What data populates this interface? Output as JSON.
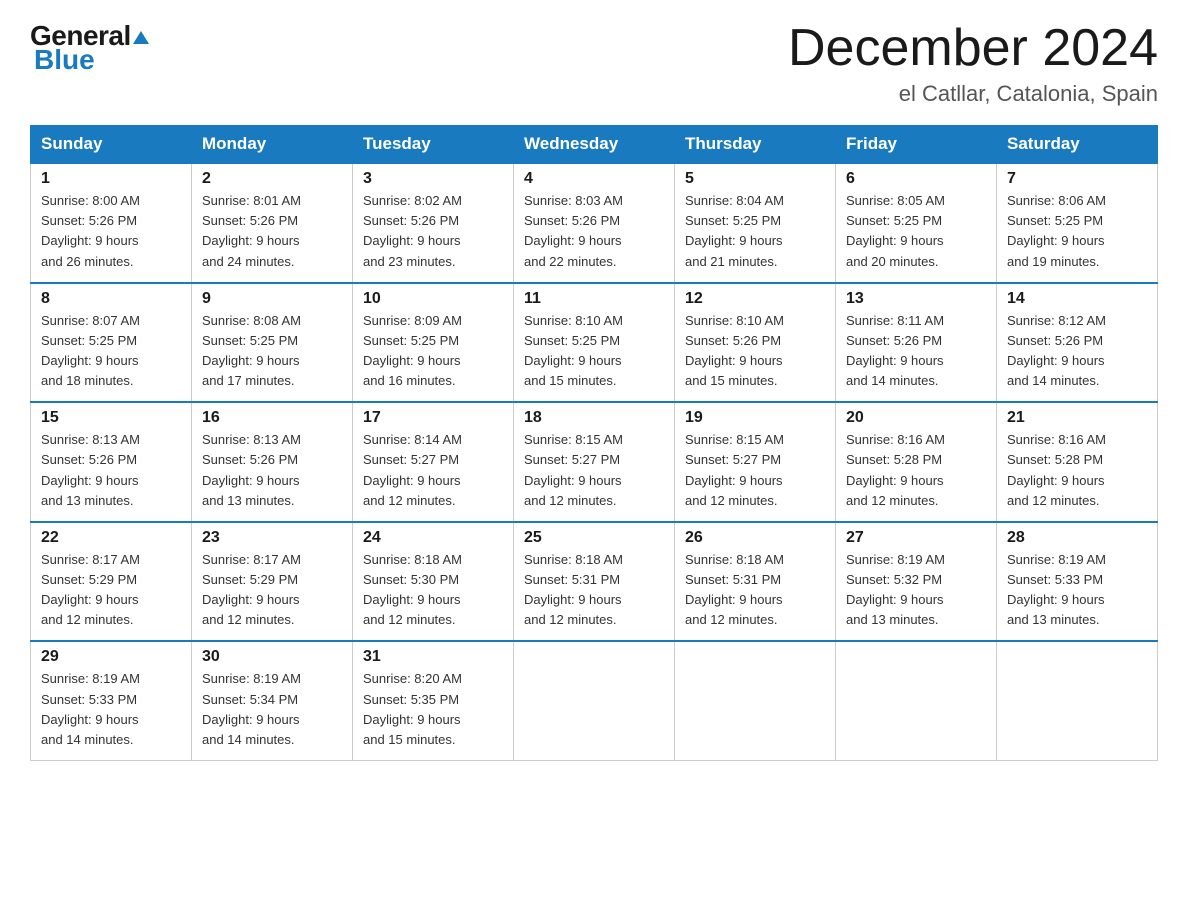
{
  "logo": {
    "general": "General",
    "blue": "Blue",
    "triangle": "▲"
  },
  "header": {
    "title": "December 2024",
    "subtitle": "el Catllar, Catalonia, Spain"
  },
  "days_of_week": [
    "Sunday",
    "Monday",
    "Tuesday",
    "Wednesday",
    "Thursday",
    "Friday",
    "Saturday"
  ],
  "weeks": [
    [
      {
        "day": "1",
        "sunrise": "8:00 AM",
        "sunset": "5:26 PM",
        "daylight": "9 hours and 26 minutes."
      },
      {
        "day": "2",
        "sunrise": "8:01 AM",
        "sunset": "5:26 PM",
        "daylight": "9 hours and 24 minutes."
      },
      {
        "day": "3",
        "sunrise": "8:02 AM",
        "sunset": "5:26 PM",
        "daylight": "9 hours and 23 minutes."
      },
      {
        "day": "4",
        "sunrise": "8:03 AM",
        "sunset": "5:26 PM",
        "daylight": "9 hours and 22 minutes."
      },
      {
        "day": "5",
        "sunrise": "8:04 AM",
        "sunset": "5:25 PM",
        "daylight": "9 hours and 21 minutes."
      },
      {
        "day": "6",
        "sunrise": "8:05 AM",
        "sunset": "5:25 PM",
        "daylight": "9 hours and 20 minutes."
      },
      {
        "day": "7",
        "sunrise": "8:06 AM",
        "sunset": "5:25 PM",
        "daylight": "9 hours and 19 minutes."
      }
    ],
    [
      {
        "day": "8",
        "sunrise": "8:07 AM",
        "sunset": "5:25 PM",
        "daylight": "9 hours and 18 minutes."
      },
      {
        "day": "9",
        "sunrise": "8:08 AM",
        "sunset": "5:25 PM",
        "daylight": "9 hours and 17 minutes."
      },
      {
        "day": "10",
        "sunrise": "8:09 AM",
        "sunset": "5:25 PM",
        "daylight": "9 hours and 16 minutes."
      },
      {
        "day": "11",
        "sunrise": "8:10 AM",
        "sunset": "5:25 PM",
        "daylight": "9 hours and 15 minutes."
      },
      {
        "day": "12",
        "sunrise": "8:10 AM",
        "sunset": "5:26 PM",
        "daylight": "9 hours and 15 minutes."
      },
      {
        "day": "13",
        "sunrise": "8:11 AM",
        "sunset": "5:26 PM",
        "daylight": "9 hours and 14 minutes."
      },
      {
        "day": "14",
        "sunrise": "8:12 AM",
        "sunset": "5:26 PM",
        "daylight": "9 hours and 14 minutes."
      }
    ],
    [
      {
        "day": "15",
        "sunrise": "8:13 AM",
        "sunset": "5:26 PM",
        "daylight": "9 hours and 13 minutes."
      },
      {
        "day": "16",
        "sunrise": "8:13 AM",
        "sunset": "5:26 PM",
        "daylight": "9 hours and 13 minutes."
      },
      {
        "day": "17",
        "sunrise": "8:14 AM",
        "sunset": "5:27 PM",
        "daylight": "9 hours and 12 minutes."
      },
      {
        "day": "18",
        "sunrise": "8:15 AM",
        "sunset": "5:27 PM",
        "daylight": "9 hours and 12 minutes."
      },
      {
        "day": "19",
        "sunrise": "8:15 AM",
        "sunset": "5:27 PM",
        "daylight": "9 hours and 12 minutes."
      },
      {
        "day": "20",
        "sunrise": "8:16 AM",
        "sunset": "5:28 PM",
        "daylight": "9 hours and 12 minutes."
      },
      {
        "day": "21",
        "sunrise": "8:16 AM",
        "sunset": "5:28 PM",
        "daylight": "9 hours and 12 minutes."
      }
    ],
    [
      {
        "day": "22",
        "sunrise": "8:17 AM",
        "sunset": "5:29 PM",
        "daylight": "9 hours and 12 minutes."
      },
      {
        "day": "23",
        "sunrise": "8:17 AM",
        "sunset": "5:29 PM",
        "daylight": "9 hours and 12 minutes."
      },
      {
        "day": "24",
        "sunrise": "8:18 AM",
        "sunset": "5:30 PM",
        "daylight": "9 hours and 12 minutes."
      },
      {
        "day": "25",
        "sunrise": "8:18 AM",
        "sunset": "5:31 PM",
        "daylight": "9 hours and 12 minutes."
      },
      {
        "day": "26",
        "sunrise": "8:18 AM",
        "sunset": "5:31 PM",
        "daylight": "9 hours and 12 minutes."
      },
      {
        "day": "27",
        "sunrise": "8:19 AM",
        "sunset": "5:32 PM",
        "daylight": "9 hours and 13 minutes."
      },
      {
        "day": "28",
        "sunrise": "8:19 AM",
        "sunset": "5:33 PM",
        "daylight": "9 hours and 13 minutes."
      }
    ],
    [
      {
        "day": "29",
        "sunrise": "8:19 AM",
        "sunset": "5:33 PM",
        "daylight": "9 hours and 14 minutes."
      },
      {
        "day": "30",
        "sunrise": "8:19 AM",
        "sunset": "5:34 PM",
        "daylight": "9 hours and 14 minutes."
      },
      {
        "day": "31",
        "sunrise": "8:20 AM",
        "sunset": "5:35 PM",
        "daylight": "9 hours and 15 minutes."
      },
      null,
      null,
      null,
      null
    ]
  ],
  "labels": {
    "sunrise": "Sunrise:",
    "sunset": "Sunset:",
    "daylight": "Daylight:"
  }
}
